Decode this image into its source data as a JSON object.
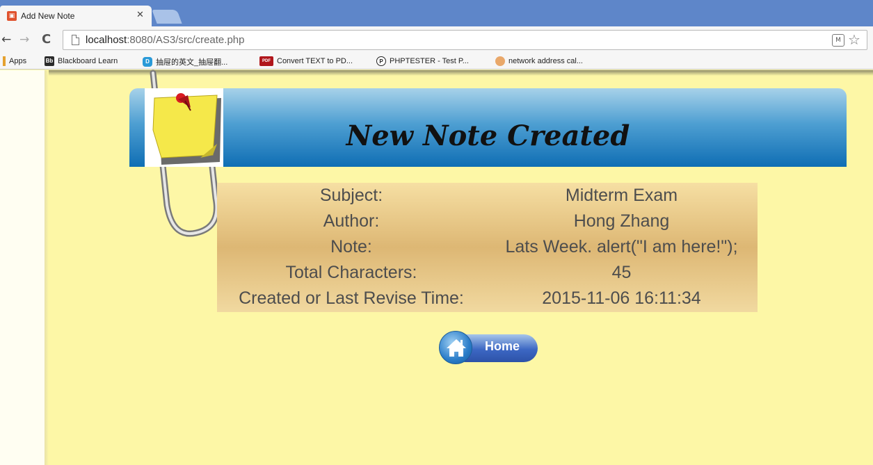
{
  "browser": {
    "tab": {
      "title": "Add New Note"
    },
    "address": {
      "host": "localhost",
      "path": ":8080/AS3/src/create.php"
    },
    "bookmarks": [
      {
        "label": "Apps"
      },
      {
        "label": "Blackboard Learn",
        "icon": "Bb"
      },
      {
        "label": "抽屉的英文_抽屉翻...",
        "icon": "D"
      },
      {
        "label": "Convert TEXT to PD...",
        "icon": "PDF"
      },
      {
        "label": "PHPTESTER - Test P...",
        "icon": "P"
      },
      {
        "label": "network address cal..."
      }
    ]
  },
  "page": {
    "title": "New Note Created",
    "rows": [
      {
        "label": "Subject:",
        "value": "Midterm Exam"
      },
      {
        "label": "Author:",
        "value": "Hong Zhang"
      },
      {
        "label": "Note:",
        "value": "Lats Week. alert(\"I am here!\");"
      },
      {
        "label": "Total Characters:",
        "value": "45"
      },
      {
        "label": "Created or Last Revise Time:",
        "value": "2015-11-06 16:11:34"
      }
    ],
    "home_label": "Home"
  },
  "colors": {
    "page_background": "#fdf7a6",
    "banner_top": "#a7d2e9",
    "banner_bottom": "#0f6eb4",
    "tabstrip": "#5e86c9"
  },
  "icons": [
    "app-favicon-icon",
    "close-icon",
    "back-arrow-icon",
    "forward-arrow-icon",
    "reload-icon",
    "page-icon",
    "extension-icon",
    "star-icon",
    "sticky-note-icon",
    "paperclip-icon",
    "home-icon"
  ]
}
